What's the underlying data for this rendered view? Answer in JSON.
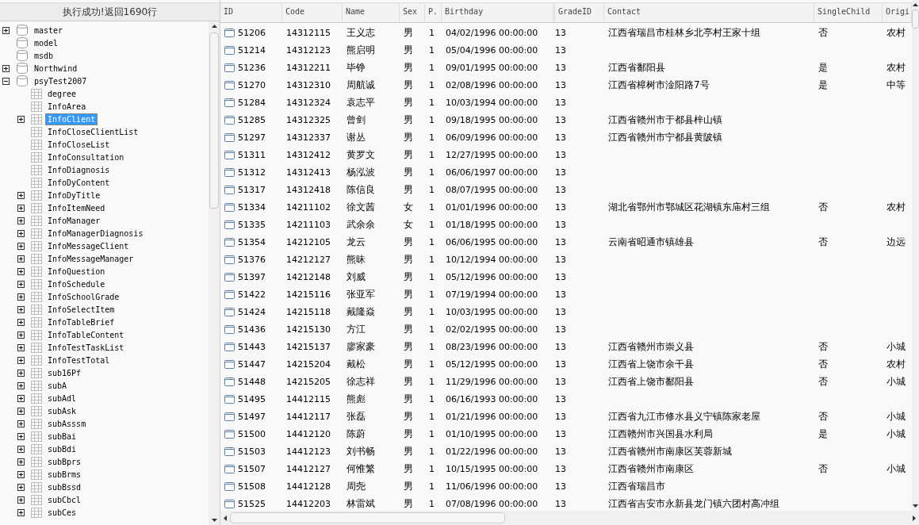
{
  "status_message": "执行成功!返回1690行",
  "tree": {
    "items": [
      {
        "label": "master",
        "kind": "database",
        "expanded": false,
        "selected": false
      },
      {
        "label": "model",
        "kind": "database",
        "selected": false
      },
      {
        "label": "msdb",
        "kind": "database",
        "selected": false
      },
      {
        "label": "Northwind",
        "kind": "database",
        "expanded": false,
        "selected": false
      },
      {
        "label": "psyTest2007",
        "kind": "database",
        "expanded": true,
        "selected": false,
        "children": [
          {
            "label": "degree",
            "kind": "table",
            "selected": false
          },
          {
            "label": "InfoArea",
            "kind": "table",
            "selected": false
          },
          {
            "label": "InfoClient",
            "kind": "table",
            "expanded": false,
            "selected": true
          },
          {
            "label": "InfoCloseClientList",
            "kind": "table",
            "selected": false
          },
          {
            "label": "InfoCloseList",
            "kind": "table",
            "selected": false
          },
          {
            "label": "InfoConsultation",
            "kind": "table",
            "selected": false
          },
          {
            "label": "InfoDiagnosis",
            "kind": "table",
            "selected": false
          },
          {
            "label": "InfoDyContent",
            "kind": "table",
            "selected": false
          },
          {
            "label": "InfoDyTitle",
            "kind": "table",
            "expanded": false,
            "selected": false
          },
          {
            "label": "InfoItemNeed",
            "kind": "table",
            "expanded": false,
            "selected": false
          },
          {
            "label": "InfoManager",
            "kind": "table",
            "expanded": false,
            "selected": false
          },
          {
            "label": "InfoManagerDiagnosis",
            "kind": "table",
            "expanded": false,
            "selected": false
          },
          {
            "label": "InfoMessageClient",
            "kind": "table",
            "expanded": false,
            "selected": false
          },
          {
            "label": "InfoMessageManager",
            "kind": "table",
            "expanded": false,
            "selected": false
          },
          {
            "label": "InfoQuestion",
            "kind": "table",
            "expanded": false,
            "selected": false
          },
          {
            "label": "InfoSchedule",
            "kind": "table",
            "expanded": false,
            "selected": false
          },
          {
            "label": "InfoSchoolGrade",
            "kind": "table",
            "expanded": false,
            "selected": false
          },
          {
            "label": "InfoSelectItem",
            "kind": "table",
            "expanded": false,
            "selected": false
          },
          {
            "label": "InfoTableBrief",
            "kind": "table",
            "expanded": false,
            "selected": false
          },
          {
            "label": "InfoTableContent",
            "kind": "table",
            "expanded": false,
            "selected": false
          },
          {
            "label": "InfoTestTaskList",
            "kind": "table",
            "expanded": false,
            "selected": false
          },
          {
            "label": "InfoTestTotal",
            "kind": "table",
            "expanded": false,
            "selected": false
          },
          {
            "label": "sub16Pf",
            "kind": "table",
            "expanded": false,
            "selected": false
          },
          {
            "label": "subA",
            "kind": "table",
            "expanded": false,
            "selected": false
          },
          {
            "label": "subAdl",
            "kind": "table",
            "expanded": false,
            "selected": false
          },
          {
            "label": "subAsk",
            "kind": "table",
            "expanded": false,
            "selected": false
          },
          {
            "label": "subAsssm",
            "kind": "table",
            "expanded": false,
            "selected": false
          },
          {
            "label": "subBai",
            "kind": "table",
            "expanded": false,
            "selected": false
          },
          {
            "label": "subBdi",
            "kind": "table",
            "expanded": false,
            "selected": false
          },
          {
            "label": "subBprs",
            "kind": "table",
            "expanded": false,
            "selected": false
          },
          {
            "label": "subBrms",
            "kind": "table",
            "expanded": false,
            "selected": false
          },
          {
            "label": "subBssd",
            "kind": "table",
            "expanded": false,
            "selected": false
          },
          {
            "label": "subCbcl",
            "kind": "table",
            "expanded": false,
            "selected": false
          },
          {
            "label": "subCes",
            "kind": "table",
            "expanded": false,
            "selected": false
          }
        ]
      }
    ]
  },
  "table": {
    "columns": [
      "ID",
      "Code",
      "Name",
      "Sex",
      "P.",
      "Birthday",
      "GradeID",
      "Contact",
      "SingleChild",
      "Origi"
    ],
    "rows": [
      {
        "id": "51206",
        "code": "14312115",
        "name": "王义志",
        "sex": "男",
        "p": "1",
        "birthday": "04/02/1996 00:00:00",
        "grade_id": "13",
        "contact": "江西省瑞昌市桂林乡北亭村王家十组",
        "single_child": "否",
        "origin": "农村"
      },
      {
        "id": "51214",
        "code": "14312123",
        "name": "熊启明",
        "sex": "男",
        "p": "1",
        "birthday": "05/04/1996 00:00:00",
        "grade_id": "13"
      },
      {
        "id": "51236",
        "code": "14312211",
        "name": "毕铮",
        "sex": "男",
        "p": "1",
        "birthday": "09/01/1995 00:00:00",
        "grade_id": "13",
        "contact": "江西省鄱阳县",
        "single_child": "是",
        "origin": "农村"
      },
      {
        "id": "51270",
        "code": "14312310",
        "name": "周航诚",
        "sex": "男",
        "p": "1",
        "birthday": "02/08/1996 00:00:00",
        "grade_id": "13",
        "contact": "江西省樟树市淦阳路7号",
        "single_child": "是",
        "origin": "中等"
      },
      {
        "id": "51284",
        "code": "14312324",
        "name": "袁志平",
        "sex": "男",
        "p": "1",
        "birthday": "10/03/1994 00:00:00",
        "grade_id": "13"
      },
      {
        "id": "51285",
        "code": "14312325",
        "name": "曾剑",
        "sex": "男",
        "p": "1",
        "birthday": "09/18/1995 00:00:00",
        "grade_id": "13",
        "contact": "江西省赣州市于都县梓山镇"
      },
      {
        "id": "51297",
        "code": "14312337",
        "name": "谢丛",
        "sex": "男",
        "p": "1",
        "birthday": "06/09/1996 00:00:00",
        "grade_id": "13",
        "contact": "江西省赣州市宁都县黄陂镇"
      },
      {
        "id": "51311",
        "code": "14312412",
        "name": "黄罗文",
        "sex": "男",
        "p": "1",
        "birthday": "12/27/1995 00:00:00",
        "grade_id": "13"
      },
      {
        "id": "51312",
        "code": "14312413",
        "name": "杨泓波",
        "sex": "男",
        "p": "1",
        "birthday": "06/06/1997 00:00:00",
        "grade_id": "13"
      },
      {
        "id": "51317",
        "code": "14312418",
        "name": "陈信良",
        "sex": "男",
        "p": "1",
        "birthday": "08/07/1995 00:00:00",
        "grade_id": "13"
      },
      {
        "id": "51334",
        "code": "14211102",
        "name": "徐文茜",
        "sex": "女",
        "p": "1",
        "birthday": "01/01/1996 00:00:00",
        "grade_id": "13",
        "contact": "湖北省鄂州市鄂城区花湖镇东庙村三组",
        "single_child": "否",
        "origin": "农村"
      },
      {
        "id": "51335",
        "code": "14211103",
        "name": "武余余",
        "sex": "女",
        "p": "1",
        "birthday": "01/18/1995 00:00:00",
        "grade_id": "13"
      },
      {
        "id": "51354",
        "code": "14212105",
        "name": "龙云",
        "sex": "男",
        "p": "1",
        "birthday": "06/06/1995 00:00:00",
        "grade_id": "13",
        "contact": "云南省昭通市镇雄县",
        "single_child": "否",
        "origin": "边远"
      },
      {
        "id": "51376",
        "code": "14212127",
        "name": "熊昧",
        "sex": "男",
        "p": "1",
        "birthday": "10/12/1994 00:00:00",
        "grade_id": "13"
      },
      {
        "id": "51397",
        "code": "14212148",
        "name": "刘威",
        "sex": "男",
        "p": "1",
        "birthday": "05/12/1996 00:00:00",
        "grade_id": "13"
      },
      {
        "id": "51422",
        "code": "14215116",
        "name": "张亚军",
        "sex": "男",
        "p": "1",
        "birthday": "07/19/1994 00:00:00",
        "grade_id": "13"
      },
      {
        "id": "51424",
        "code": "14215118",
        "name": "戴隆焱",
        "sex": "男",
        "p": "1",
        "birthday": "10/03/1995 00:00:00",
        "grade_id": "13"
      },
      {
        "id": "51436",
        "code": "14215130",
        "name": "方江",
        "sex": "男",
        "p": "1",
        "birthday": "02/02/1995 00:00:00",
        "grade_id": "13"
      },
      {
        "id": "51443",
        "code": "14215137",
        "name": "廖家豪",
        "sex": "男",
        "p": "1",
        "birthday": "08/23/1996 00:00:00",
        "grade_id": "13",
        "contact": "江西省赣州市崇义县",
        "single_child": "否",
        "origin": "小城"
      },
      {
        "id": "51447",
        "code": "14215204",
        "name": "戴松",
        "sex": "男",
        "p": "1",
        "birthday": "05/12/1995 00:00:00",
        "grade_id": "13",
        "contact": "江西省上饶市余干县",
        "single_child": "否",
        "origin": "农村"
      },
      {
        "id": "51448",
        "code": "14215205",
        "name": "徐志祥",
        "sex": "男",
        "p": "1",
        "birthday": "11/29/1996 00:00:00",
        "grade_id": "13",
        "contact": "江西省上饶市鄱阳县",
        "single_child": "否",
        "origin": "小城"
      },
      {
        "id": "51495",
        "code": "14412115",
        "name": "熊彪",
        "sex": "男",
        "p": "1",
        "birthday": "06/16/1993 00:00:00",
        "grade_id": "13"
      },
      {
        "id": "51497",
        "code": "14412117",
        "name": "张磊",
        "sex": "男",
        "p": "1",
        "birthday": "01/21/1996 00:00:00",
        "grade_id": "13",
        "contact": "江西省九江市修水县义宁镇陈家老屋",
        "single_child": "否",
        "origin": "小城"
      },
      {
        "id": "51500",
        "code": "14412120",
        "name": "陈蔚",
        "sex": "男",
        "p": "1",
        "birthday": "01/10/1995 00:00:00",
        "grade_id": "13",
        "contact": "江西赣州市兴国县水利局",
        "single_child": "是",
        "origin": "小城"
      },
      {
        "id": "51503",
        "code": "14412123",
        "name": "刘书畅",
        "sex": "男",
        "p": "1",
        "birthday": "01/22/1996 00:00:00",
        "grade_id": "13",
        "contact": "江西省赣州市南康区芙蓉新城"
      },
      {
        "id": "51507",
        "code": "14412127",
        "name": "何惟繁",
        "sex": "男",
        "p": "1",
        "birthday": "10/15/1995 00:00:00",
        "grade_id": "13",
        "contact": "江西省赣州市南康区",
        "single_child": "否",
        "origin": "小城"
      },
      {
        "id": "51508",
        "code": "14412128",
        "name": "周尧",
        "sex": "男",
        "p": "1",
        "birthday": "11/06/1996 00:00:00",
        "grade_id": "13",
        "contact": "江西省瑞昌市"
      },
      {
        "id": "51525",
        "code": "14412203",
        "name": "林雷斌",
        "sex": "男",
        "p": "1",
        "birthday": "07/08/1996 00:00:00",
        "grade_id": "13",
        "contact": "江西省吉安市永新县龙门镇六团村高冲组"
      }
    ]
  }
}
